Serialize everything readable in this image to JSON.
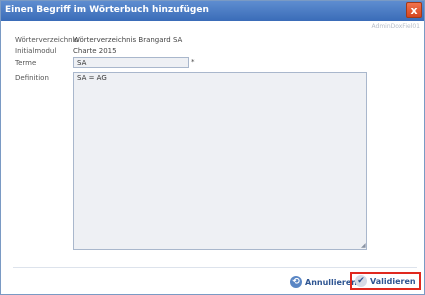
{
  "window": {
    "title": "Einen Begriff im Wörterbuch hinzufügen",
    "close_glyph": "x",
    "corner_label": "AdminDoxFiel01"
  },
  "form": {
    "dictionary_label": "Wörterverzeichnis",
    "dictionary_value": "Wörterverzeichnis Brangard SA",
    "module_label": "Initialmodul",
    "module_value": "Charte 2015",
    "term_label": "Terme",
    "term_value": "SA",
    "required_mark": "*",
    "definition_label": "Definition",
    "definition_value": "SA = AG"
  },
  "buttons": {
    "cancel_label": "Annullieren",
    "validate_label": "Validieren"
  },
  "icons": {
    "close": "close-icon",
    "cancel": "cancel-icon",
    "validate": "checkmark-icon",
    "resize": "resize-grip-icon"
  },
  "colors": {
    "titlebar": "#4a7cc4",
    "close_button": "#e2552f",
    "highlight_border": "#e0281e"
  }
}
